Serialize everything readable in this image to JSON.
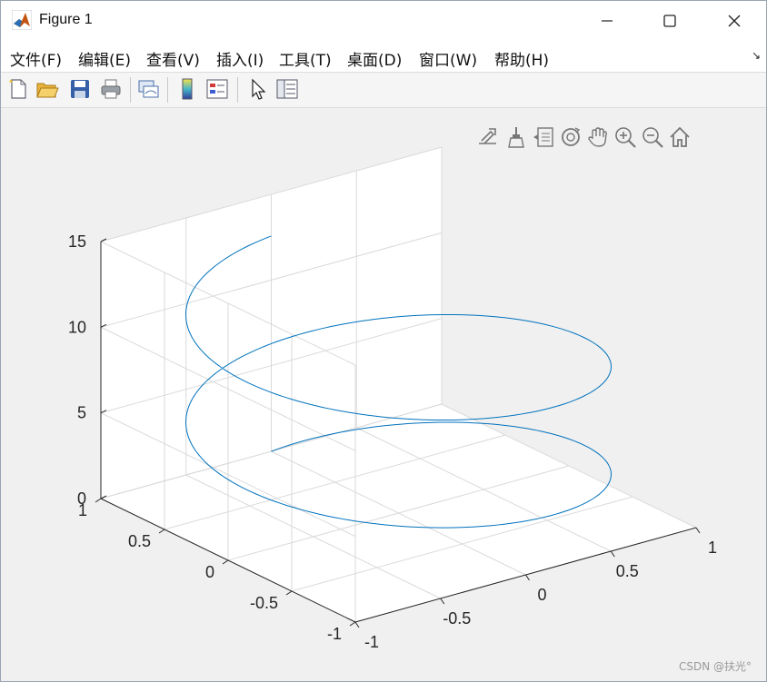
{
  "window": {
    "title": "Figure 1"
  },
  "menu": {
    "items": [
      "文件(F)",
      "编辑(E)",
      "查看(V)",
      "插入(I)",
      "工具(T)",
      "桌面(D)",
      "窗口(W)",
      "帮助(H)"
    ],
    "overflow_arrow": "↘"
  },
  "toolbar": {
    "icons": [
      "new-figure-icon",
      "open-file-icon",
      "save-icon",
      "print-icon",
      "link-plot-icon",
      "insert-colorbar-icon",
      "insert-legend-icon",
      "edit-plot-arrow-icon",
      "property-inspector-icon"
    ]
  },
  "axes_toolbar": {
    "icons": [
      "export-icon",
      "brush-icon",
      "data-tips-icon",
      "rotate-3d-icon",
      "pan-hand-icon",
      "zoom-in-icon",
      "zoom-out-icon",
      "home-icon"
    ]
  },
  "chart_data": {
    "type": "line",
    "subtype": "3d-helix",
    "series": [
      {
        "x_formula": "sin(t)",
        "y_formula": "cos(t)",
        "z_formula": "t",
        "t_range": [
          0,
          12.566
        ],
        "color": "#0072BD"
      }
    ],
    "z_ticks": [
      "0",
      "5",
      "10",
      "15"
    ],
    "x_ticks": [
      "-1",
      "-0.5",
      "0",
      "0.5",
      "1"
    ],
    "y_ticks": [
      "-1",
      "-0.5",
      "0",
      "0.5",
      "1"
    ],
    "zlim": [
      0,
      15
    ],
    "xlim": [
      -1,
      1
    ],
    "ylim": [
      -1,
      1
    ],
    "grid": true
  },
  "watermark": "CSDN @扶光°"
}
